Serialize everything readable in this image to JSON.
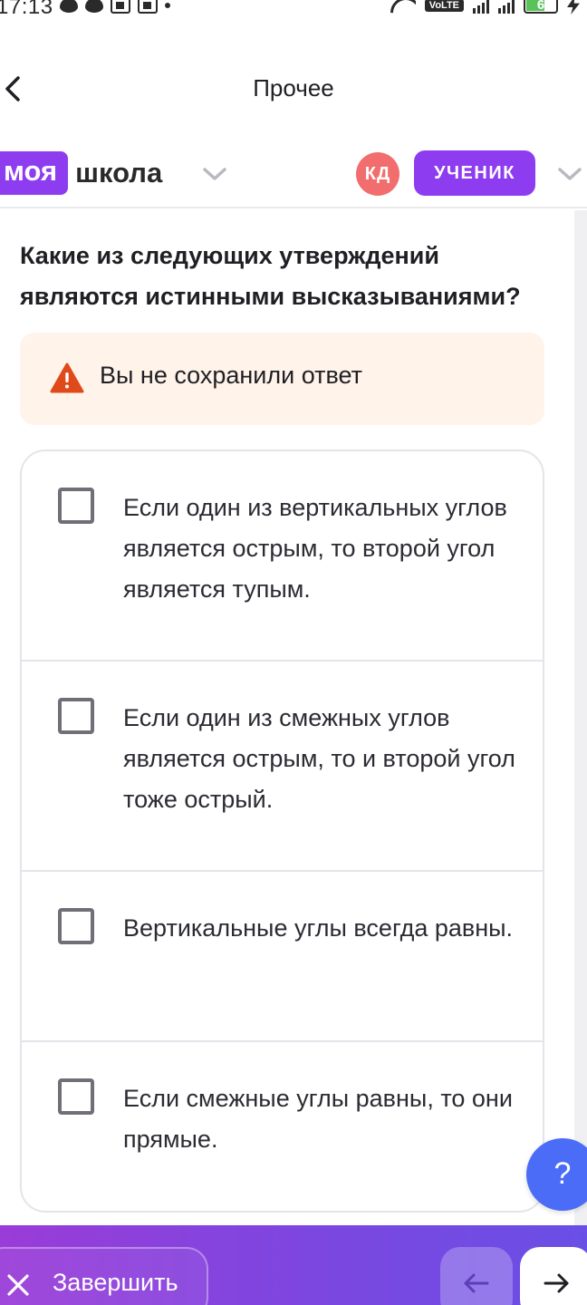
{
  "status_bar": {
    "time": "17:13",
    "network_badge": "VoLTE",
    "battery_level": "6"
  },
  "header": {
    "title": "Прочее"
  },
  "brand": {
    "logo_part1": "моя",
    "logo_part2": "школа",
    "avatar_initials": "КД",
    "role": "УЧЕНИК",
    "colors": {
      "accent": "#8e3cf0",
      "avatar": "#f26d6d"
    }
  },
  "question": {
    "text": "Какие из следующих утверждений являются истинными высказываниями?"
  },
  "warning": {
    "text": "Вы не сохранили ответ",
    "icon": "warning-icon",
    "color": "#e04a1a"
  },
  "options": [
    {
      "text": "Если один из вертикальных углов является острым, то второй угол является тупым.",
      "checked": false
    },
    {
      "text": "Если один из смежных углов является острым, то и второй угол тоже острый.",
      "checked": false
    },
    {
      "text": "Вертикальные углы всегда равны.",
      "checked": false
    },
    {
      "text": "Если смежные углы равны, то они прямые.",
      "checked": false
    }
  ],
  "help": {
    "label": "?"
  },
  "footer": {
    "finish_label": "Завершить",
    "prev_icon": "arrow-left-icon",
    "next_icon": "arrow-right-icon"
  }
}
